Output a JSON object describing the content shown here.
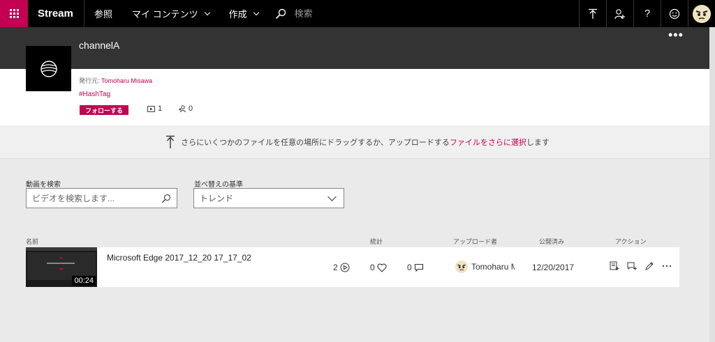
{
  "nav": {
    "brand": "Stream",
    "items": [
      {
        "label": "参照",
        "has_dropdown": false
      },
      {
        "label": "マイ コンテンツ",
        "has_dropdown": true
      },
      {
        "label": "作成",
        "has_dropdown": true
      }
    ],
    "search_placeholder": "検索",
    "right_icons": [
      "upload-icon",
      "add-user-icon",
      "help-icon",
      "smiley-icon",
      "user-avatar"
    ]
  },
  "channel": {
    "title": "channelA",
    "publisher_prefix": "発行元: ",
    "publisher_name": "Tomoharu Misawa",
    "hashtag": "#HashTag",
    "follow_label": "フォローする",
    "video_count": "1",
    "follower_count": "0",
    "more_label": "•••"
  },
  "upload": {
    "prefix": "さらにいくつかのファイルを任意の場所にドラッグするか、アップロードする",
    "link": "ファイルをさらに選択",
    "suffix": "します"
  },
  "filters": {
    "search_label": "動画を検索",
    "search_placeholder": "ビデオを検索します...",
    "sort_label": "並べ替えの基準",
    "sort_value": "トレンド"
  },
  "table": {
    "headers": {
      "name": "名前",
      "stats": "統計",
      "uploader": "アップロード者",
      "published": "公開済み",
      "actions": "アクション"
    },
    "rows": [
      {
        "title": "Microsoft Edge 2017_12_20 17_17_02",
        "duration": "00:24",
        "views": "2",
        "likes": "0",
        "comments": "0",
        "uploader": "Tomoharu M",
        "uploader_fade": "i",
        "published": "12/20/2017"
      }
    ]
  },
  "colors": {
    "accent": "#c30052",
    "nav_bg": "#000000",
    "channel_bg": "#333333"
  }
}
